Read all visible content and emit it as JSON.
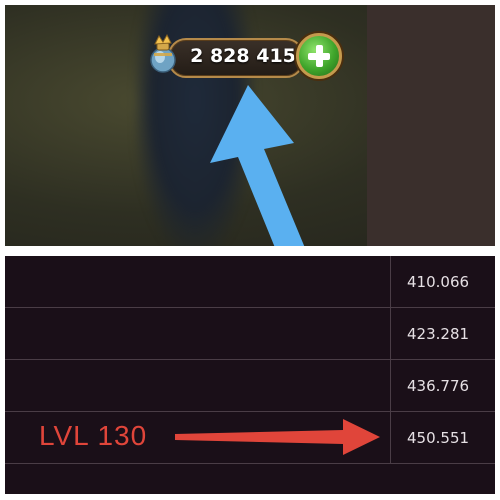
{
  "game": {
    "currency": {
      "amount": "2 828 415",
      "currency_icon": "vase-icon",
      "add_icon": "plus-icon"
    },
    "arrow": {
      "color": "#5ab0f0",
      "direction": "up"
    }
  },
  "xp_table": {
    "rows": [
      {
        "value": "410.066"
      },
      {
        "value": "423.281"
      },
      {
        "value": "436.776"
      },
      {
        "value": "450.551",
        "label": "LVL 130"
      }
    ],
    "highlight_color": "#e0453a"
  }
}
